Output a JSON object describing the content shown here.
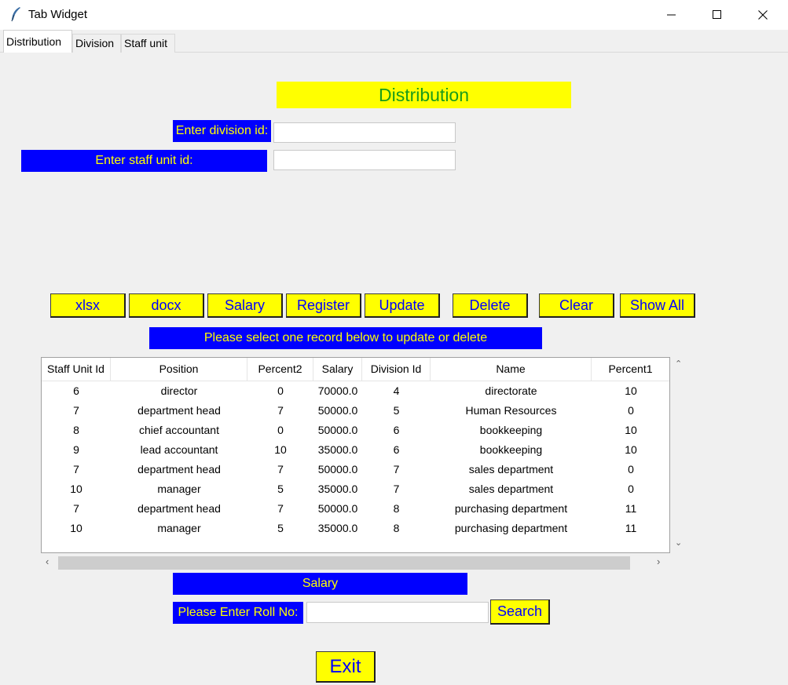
{
  "window": {
    "title": "Tab Widget"
  },
  "tabs": [
    {
      "label": "Distribution",
      "active": true
    },
    {
      "label": "Division",
      "active": false
    },
    {
      "label": "Staff unit",
      "active": false
    }
  ],
  "form": {
    "heading": "Distribution",
    "division_label": "Enter division id:",
    "division_value": "",
    "staff_label": "Enter staff unit id:",
    "staff_value": ""
  },
  "toolbar": {
    "xlsx": "xlsx",
    "docx": "docx",
    "salary": "Salary",
    "register": "Register",
    "update": "Update",
    "delete": "Delete",
    "clear": "Clear",
    "show_all": "Show All"
  },
  "instruction": "Please select one record below to update or delete",
  "table": {
    "columns": [
      "Staff Unit Id",
      "Position",
      "Percent2",
      "Salary",
      "Division Id",
      "Name",
      "Percent1"
    ],
    "rows": [
      [
        "6",
        "director",
        "0",
        "70000.0",
        "4",
        "directorate",
        "10"
      ],
      [
        "7",
        "department head",
        "7",
        "50000.0",
        "5",
        "Human Resources",
        "0"
      ],
      [
        "8",
        "chief accountant",
        "0",
        "50000.0",
        "6",
        "bookkeeping",
        "10"
      ],
      [
        "9",
        "lead accountant",
        "10",
        "35000.0",
        "6",
        "bookkeeping",
        "10"
      ],
      [
        "7",
        "department head",
        "7",
        "50000.0",
        "7",
        "sales department",
        "0"
      ],
      [
        "10",
        "manager",
        "5",
        "35000.0",
        "7",
        "sales department",
        "0"
      ],
      [
        "7",
        "department head",
        "7",
        "50000.0",
        "8",
        "purchasing department",
        "11"
      ],
      [
        "10",
        "manager",
        "5",
        "35000.0",
        "8",
        "purchasing department",
        "11"
      ]
    ]
  },
  "salary_section": {
    "title": "Salary",
    "roll_label": "Please Enter Roll No:",
    "roll_value": "",
    "search": "Search"
  },
  "exit": "Exit",
  "colors": {
    "label_bg": "#0000ff",
    "label_fg": "#ffff00",
    "button_bg": "#ffff00",
    "button_fg": "#0000ff",
    "heading_fg": "#1a9c1a"
  },
  "icons": {
    "app": "feather-icon",
    "minimize": "minimize-icon",
    "maximize": "maximize-icon",
    "close": "close-icon"
  }
}
